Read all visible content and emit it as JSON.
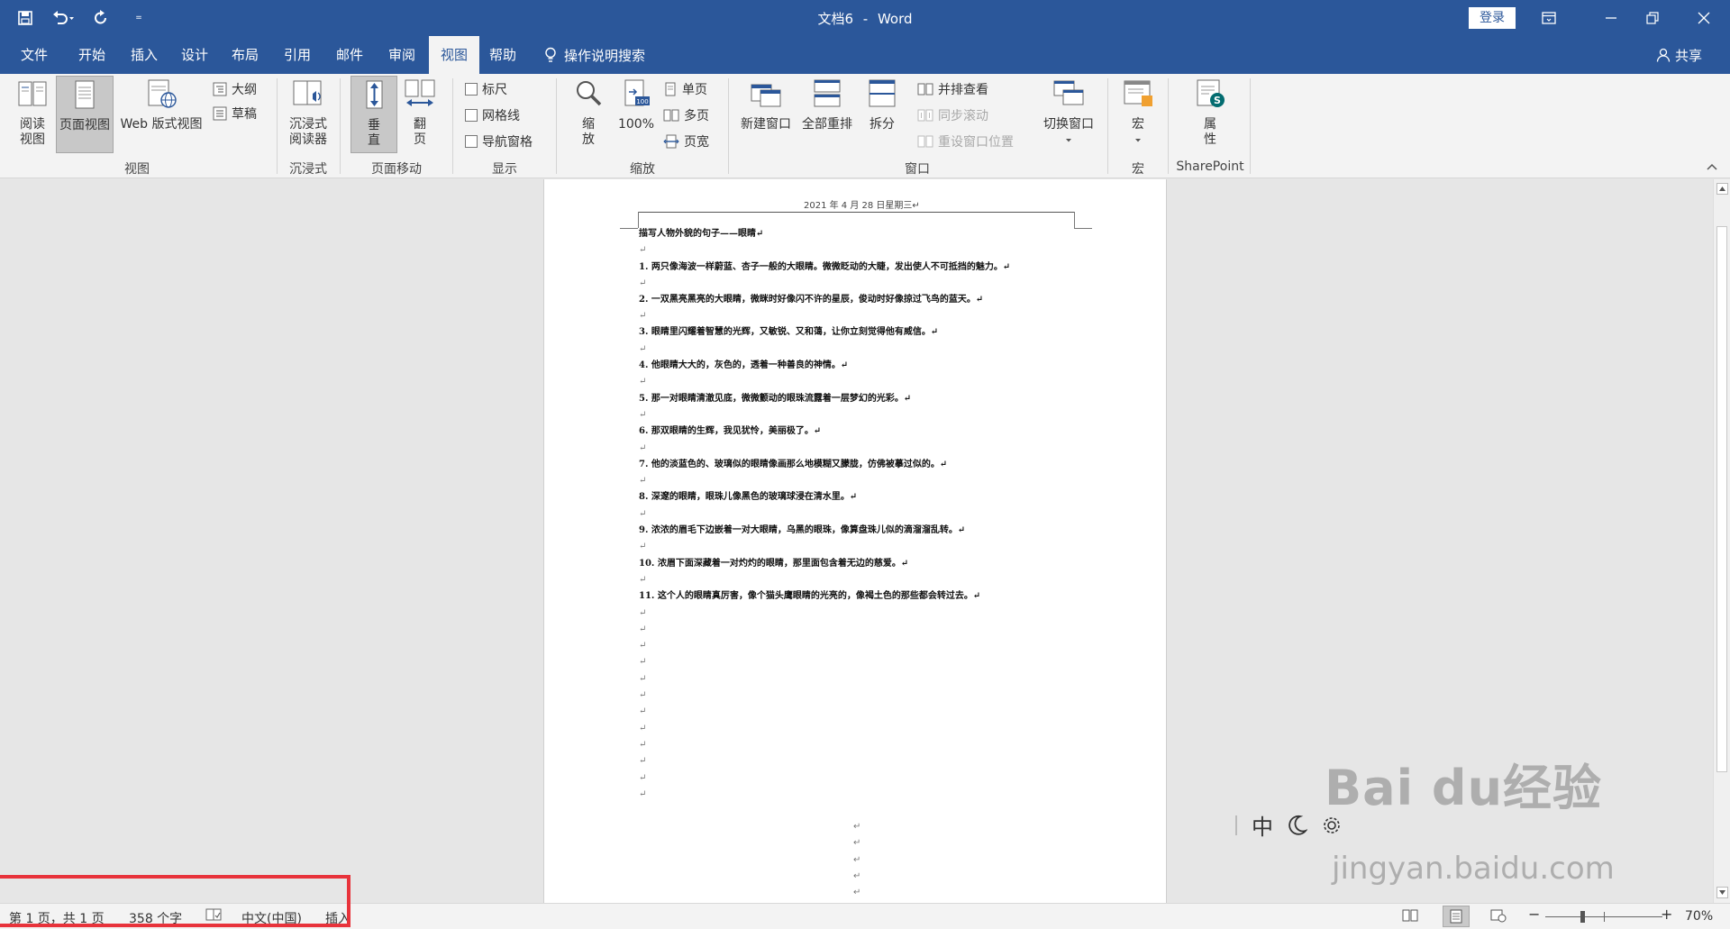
{
  "titlebar": {
    "doc_name": "文档6",
    "separator": "-",
    "app_name": "Word",
    "login": "登录",
    "customize_qat": "="
  },
  "tabs": [
    {
      "label": "文件"
    },
    {
      "label": "开始"
    },
    {
      "label": "插入"
    },
    {
      "label": "设计"
    },
    {
      "label": "布局"
    },
    {
      "label": "引用"
    },
    {
      "label": "邮件"
    },
    {
      "label": "审阅"
    },
    {
      "label": "视图",
      "active": true
    },
    {
      "label": "帮助"
    }
  ],
  "search": {
    "label": "操作说明搜索"
  },
  "share": {
    "label": "共享"
  },
  "ribbon": {
    "views": {
      "group": "视图",
      "read_mode": "阅读\n视图",
      "print_layout": "页面视图",
      "web_layout": "Web 版式视图",
      "outline": "大纲",
      "draft": "草稿"
    },
    "immersive": {
      "group": "沉浸式",
      "reader": "沉浸式\n阅读器"
    },
    "page_movement": {
      "group": "页面移动",
      "vertical": "垂\n直",
      "side_to_side": "翻\n页"
    },
    "show": {
      "group": "显示",
      "ruler": "标尺",
      "gridlines": "网格线",
      "nav_pane": "导航窗格"
    },
    "zoom": {
      "group": "缩放",
      "zoom": "缩\n放",
      "hundred": "100%",
      "one_page": "单页",
      "multi_page": "多页",
      "page_width": "页宽"
    },
    "window": {
      "group": "窗口",
      "new_window": "新建窗口",
      "arrange_all": "全部重排",
      "split": "拆分",
      "side_by_side": "并排查看",
      "sync_scroll": "同步滚动",
      "reset_position": "重设窗口位置",
      "switch_windows": "切换窗口"
    },
    "macros": {
      "group": "宏",
      "macros": "宏"
    },
    "sharepoint": {
      "group": "SharePoint",
      "properties": "属\n性"
    }
  },
  "document": {
    "header_text": "2021 年 4 月 28 日星期三↵",
    "title": "描写人物外貌的句子——眼睛↵",
    "para_mark": "↵",
    "items": [
      "1. 两只像海波一样蔚蓝、杏子一般的大眼睛。微微眨动的大睫，发出使人不可抵挡的魅力。↵",
      "2. 一双黑亮黑亮的大眼睛，微眯时好像闪不许的星辰，俊动时好像掠过飞鸟的蓝天。↵",
      "3. 眼睛里闪耀着智慧的光辉，又敏锐、又和蔼，让你立刻觉得他有威信。↵",
      "4. 他眼睛大大的，灰色的，透着一种善良的神情。↵",
      "5. 那一对眼睛清澈见底，微微颤动的眼珠流露着一层梦幻的光彩。↵",
      "6. 那双眼睛的生辉，我见犹怜，美丽极了。↵",
      "7. 他的淡蓝色的、玻璃似的眼睛像画那么地模糊又朦胧，仿佛被摹过似的。↵",
      "8. 深邃的眼睛，眼珠儿像黑色的玻璃球浸在清水里。↵",
      "9. 浓浓的眉毛下边嵌着一对大眼睛，乌黑的眼珠，像算盘珠儿似的滴溜溜乱转。↵",
      "10. 浓眉下面深藏着一对灼灼的眼睛，那里面包含着无边的慈爱。↵",
      "11. 这个人的眼睛真厉害，像个猫头鹰眼睛的光亮的，像褐土色的那些都会转过去。↵"
    ]
  },
  "statusbar": {
    "page_info": "第 1 页，共 1 页",
    "word_count": "358 个字",
    "language": "中文(中国)",
    "insert_mode": "插入",
    "zoom_minus": "−",
    "zoom_plus": "+",
    "zoom_level": "70%",
    "zoom_fraction": 0.3
  },
  "ime": {
    "mode": "中"
  },
  "watermark": {
    "brand": "Bai du经验",
    "url": "jingyan.baidu.com"
  },
  "colors": {
    "accent": "#2b579a",
    "highlight_box": "#e8333b",
    "ribbon_bg": "#f3f3f3"
  }
}
